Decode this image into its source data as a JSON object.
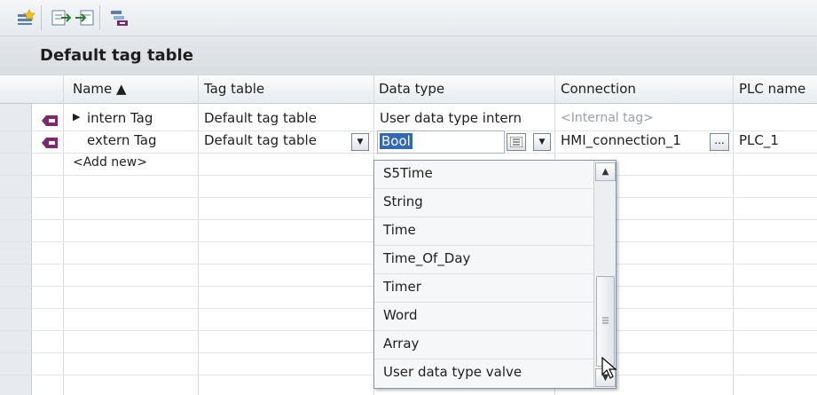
{
  "toolbar": {
    "buttons": [
      {
        "icon": "add-tag-icon"
      },
      {
        "icon": "export-icon"
      },
      {
        "icon": "import-icon"
      },
      {
        "icon": "tag-table-icon"
      }
    ]
  },
  "table_title": "Default tag table",
  "columns": [
    "Name ▲",
    "Tag table",
    "Data type",
    "Connection",
    "PLC name"
  ],
  "rows": [
    {
      "name": "intern Tag",
      "tag_table": "Default tag table",
      "data_type": "User data type intern",
      "connection": "<Internal tag>",
      "plc_name": ""
    },
    {
      "name": "extern Tag",
      "tag_table": "Default tag table",
      "data_type": "Bool",
      "connection": "HMI_connection_1",
      "plc_name": "PLC_1"
    }
  ],
  "add_new": "<Add new>",
  "dropdown": {
    "items": [
      "S5Time",
      "String",
      "Time",
      "Time_Of_Day",
      "Timer",
      "Word",
      "Array",
      "User data type valve"
    ]
  },
  "colors": {
    "selection": "#3368b5",
    "row_header": "#e7ebef",
    "tag_icon": "#7a2a6e"
  }
}
